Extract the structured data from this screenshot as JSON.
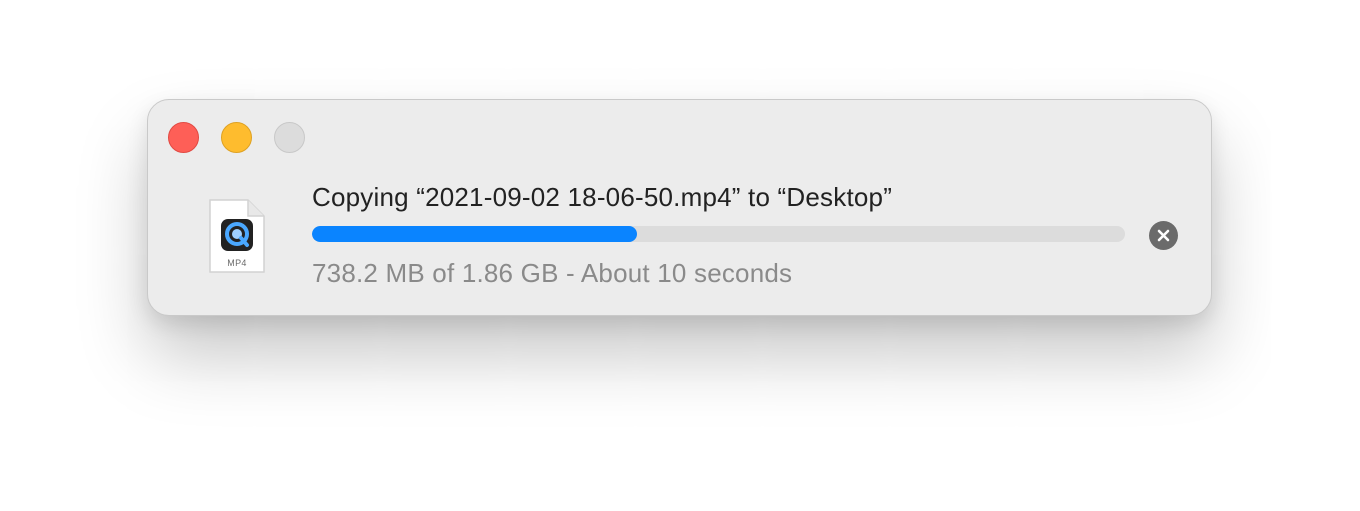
{
  "window": {
    "traffic_lights": [
      "close-icon",
      "minimize-icon",
      "zoom-icon"
    ]
  },
  "file": {
    "icon": "quicktime-file-icon",
    "extension_label": "MP4"
  },
  "copy": {
    "title": "Copying “2021-09-02 18-06-50.mp4” to “Desktop”",
    "status": "738.2 MB of 1.86 GB - About 10 seconds",
    "progress_fraction": 0.4,
    "stop_icon": "stop-x-icon"
  },
  "colors": {
    "accent": "#0a84ff",
    "close": "#fe5f57",
    "minimize": "#febc2e",
    "zoom_inactive": "#dcdcdc"
  }
}
